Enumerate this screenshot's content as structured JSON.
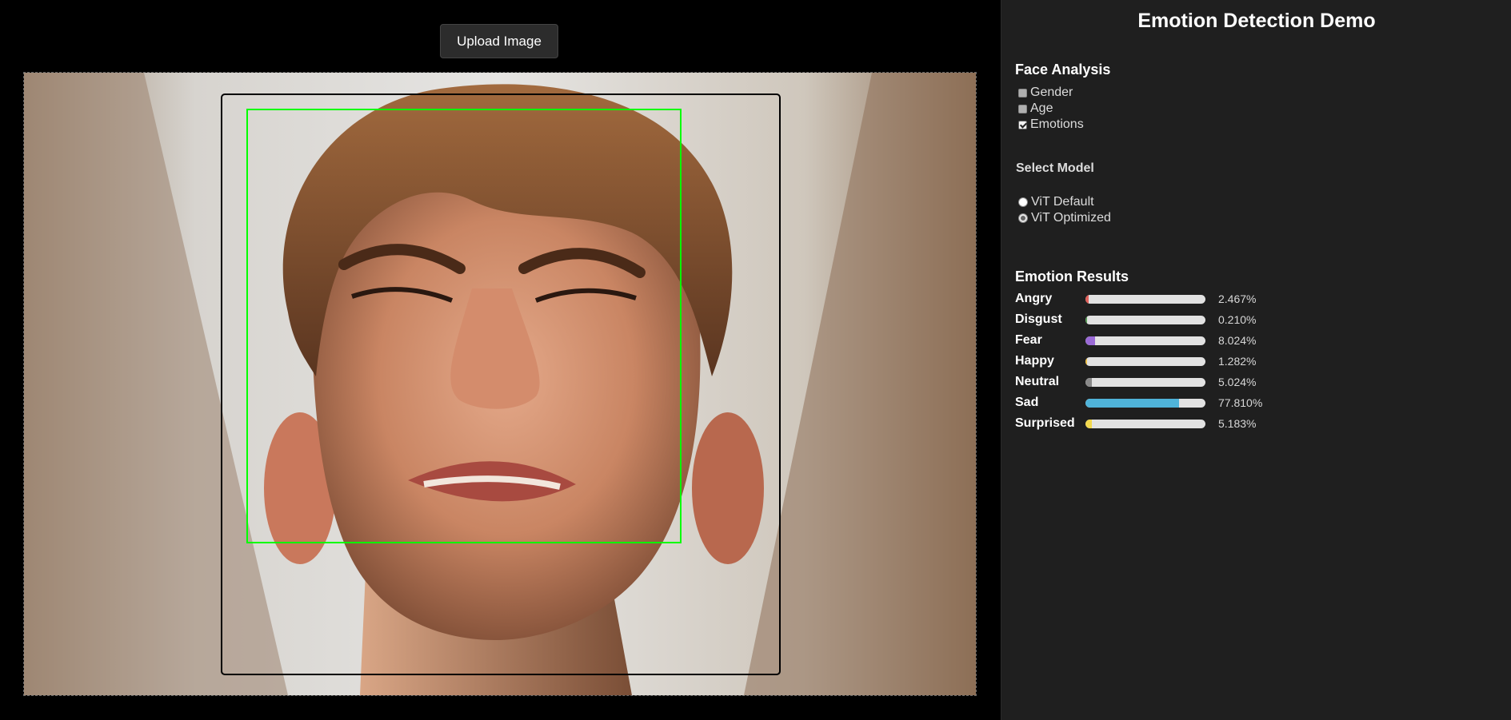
{
  "upload": {
    "label": "Upload Image"
  },
  "sidebar": {
    "title": "Emotion Detection Demo",
    "face_analysis": {
      "title": "Face Analysis",
      "options": [
        {
          "label": "Gender",
          "checked": false
        },
        {
          "label": "Age",
          "checked": false
        },
        {
          "label": "Emotions",
          "checked": true
        }
      ]
    },
    "model": {
      "title": "Select Model",
      "options": [
        {
          "label": "ViT Default",
          "selected": false
        },
        {
          "label": "ViT Optimized",
          "selected": true
        }
      ]
    },
    "results": {
      "title": "Emotion Results",
      "items": [
        {
          "label": "Angry",
          "value": "2.467%",
          "fraction": 0.02467,
          "color": "#e0605a"
        },
        {
          "label": "Disgust",
          "value": "0.210%",
          "fraction": 0.0021,
          "color": "#5aa05a"
        },
        {
          "label": "Fear",
          "value": "8.024%",
          "fraction": 0.08024,
          "color": "#9a6ad6"
        },
        {
          "label": "Happy",
          "value": "1.282%",
          "fraction": 0.01282,
          "color": "#f0c24a"
        },
        {
          "label": "Neutral",
          "value": "5.024%",
          "fraction": 0.05024,
          "color": "#8a8a8a"
        },
        {
          "label": "Sad",
          "value": "77.810%",
          "fraction": 0.7781,
          "color": "#4fb3d9"
        },
        {
          "label": "Surprised",
          "value": "5.183%",
          "fraction": 0.05183,
          "color": "#f2d94e"
        }
      ]
    }
  },
  "detection": {
    "box_color": "#00ff00"
  }
}
